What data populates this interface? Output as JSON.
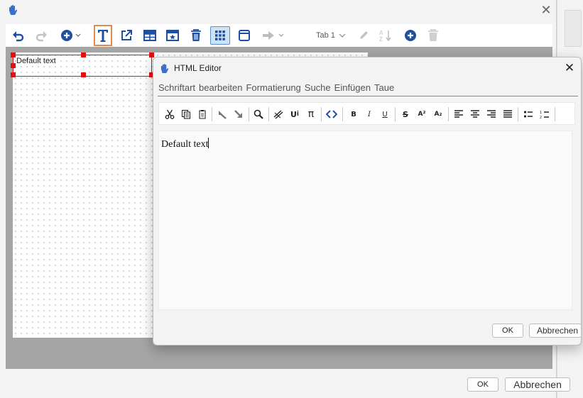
{
  "outer_window": {
    "close_symbol": "✕",
    "app_icon": "hand-icon",
    "toolbar": {
      "items": [
        "undo-icon",
        "redo-icon",
        "add-circle-dropdown-icon",
        "text-icon",
        "export-icon",
        "table-icon",
        "image-frame-icon",
        "trash-icon",
        "grid-icon",
        "frame-icon",
        "arrow-dropdown-icon",
        "pencil-icon",
        "sort-icon",
        "add-circle-icon",
        "trash-disabled-icon"
      ],
      "tab_select": "Tab 1"
    },
    "canvas": {
      "text_box_content": "Default text"
    },
    "buttons": {
      "ok": "OK",
      "cancel": "Abbrechen"
    }
  },
  "dialog": {
    "title": "HTML Editor",
    "close_symbol": "✕",
    "menu": [
      "Schriftart",
      "bearbeiten",
      "Formatierung",
      "Suche",
      "Einfügen",
      "Taue"
    ],
    "format_toolbar": {
      "bold": "B",
      "italic": "I",
      "underline": "U",
      "strike": "S",
      "superscript": "A²",
      "subscript": "A₂",
      "pi": "π",
      "unicode": "U"
    },
    "editor_content": "Default text",
    "buttons": {
      "ok": "OK",
      "cancel": "Abbrechen"
    }
  },
  "colors": {
    "accent_blue": "#1f4fa3",
    "selection_red": "#e01010",
    "selected_tool_border": "#e08a4e",
    "active_tool_bg": "#cfe3f7"
  }
}
